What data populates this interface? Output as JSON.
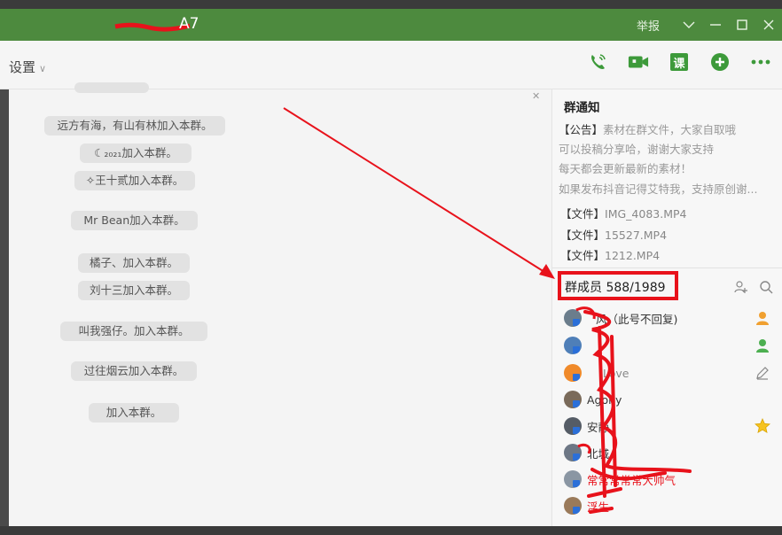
{
  "titlebar": {
    "title": "A7",
    "report": "举报",
    "chevron_icon": "chevron-down-icon",
    "minimize_icon": "minimize-icon",
    "maximize_icon": "maximize-icon",
    "close_icon": "close-icon"
  },
  "toolbar": {
    "settings_label": "设置",
    "tools": [
      {
        "name": "phone-icon"
      },
      {
        "name": "video-icon"
      },
      {
        "name": "class-icon",
        "label": "课"
      },
      {
        "name": "add-app-icon"
      },
      {
        "name": "more-icon"
      }
    ]
  },
  "chat": {
    "messages": [
      "远方有海，有山有林加入本群。",
      "☾₂₀₂₁加入本群。",
      "✧王十贰加入本群。",
      "Mr Bean加入本群。",
      "橘子、加入本群。",
      "刘十三加入本群。",
      "叫我强仔。加入本群。",
      "过往烟云加入本群。",
      "加入本群。"
    ]
  },
  "notice": {
    "title": "群通知",
    "tag": "【公告】",
    "lines": [
      "素材在群文件，大家自取哦",
      "可以投稿分享哈，谢谢大家支持",
      "每天都会更新最新的素材！",
      "如果发布抖音记得艾特我，支持原创谢..."
    ],
    "file_tag": "【文件】",
    "files": [
      "IMG_4083.MP4",
      "15527.MP4",
      "1212.MP4"
    ]
  },
  "members": {
    "label": "群成员 588/1989",
    "list": [
      {
        "name": "风（此号不回复)",
        "role": "owner"
      },
      {
        "name": "",
        "role": "admin"
      },
      {
        "name": "Love",
        "role": "edit"
      },
      {
        "name": "Agony",
        "role": ""
      },
      {
        "name": "安静",
        "role": "star"
      },
      {
        "name": "北城",
        "role": ""
      },
      {
        "name": "常常常常常大帅气",
        "role": "",
        "red": true
      },
      {
        "name": "浮生",
        "role": ""
      }
    ]
  },
  "colors": {
    "titlebar": "#4d8a3e",
    "accent_green": "#3d9a3a",
    "annotation_red": "#e8121b"
  }
}
